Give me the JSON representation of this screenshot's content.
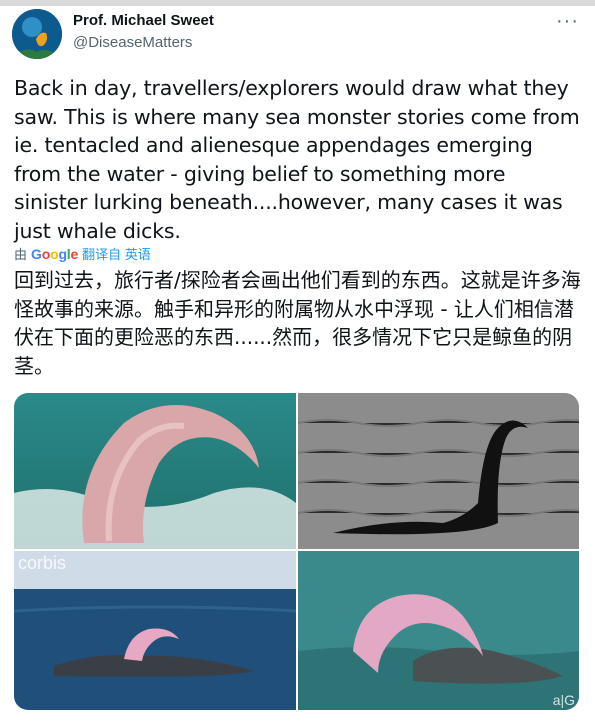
{
  "author": {
    "name": "Prof. Michael Sweet",
    "handle": "@DiseaseMatters"
  },
  "more_label": "···",
  "tweet_text": "Back in day, travellers/explorers would draw what they saw. This is where many sea monster stories come from ie. tentacled and alienesque appendages emerging from the water - giving belief to something more sinister lurking beneath....however, many cases it was just whale dicks.",
  "translation": {
    "prefix": "由",
    "brand": "Google",
    "action": "翻译自 英语",
    "text": "回到过去，旅行者/探险者会画出他们看到的东西。这就是许多海怪故事的来源。触手和异形的附属物从水中浮现 - 让人们相信潜伏在下面的更险恶的东西......然而，很多情况下它只是鲸鱼的阴茎。"
  },
  "media": {
    "watermark_1": "corbis",
    "watermark_2": "a|G"
  },
  "colors": {
    "link": "#1d9bf0",
    "secondary_text": "#536471",
    "primary_text": "#0f1419"
  }
}
